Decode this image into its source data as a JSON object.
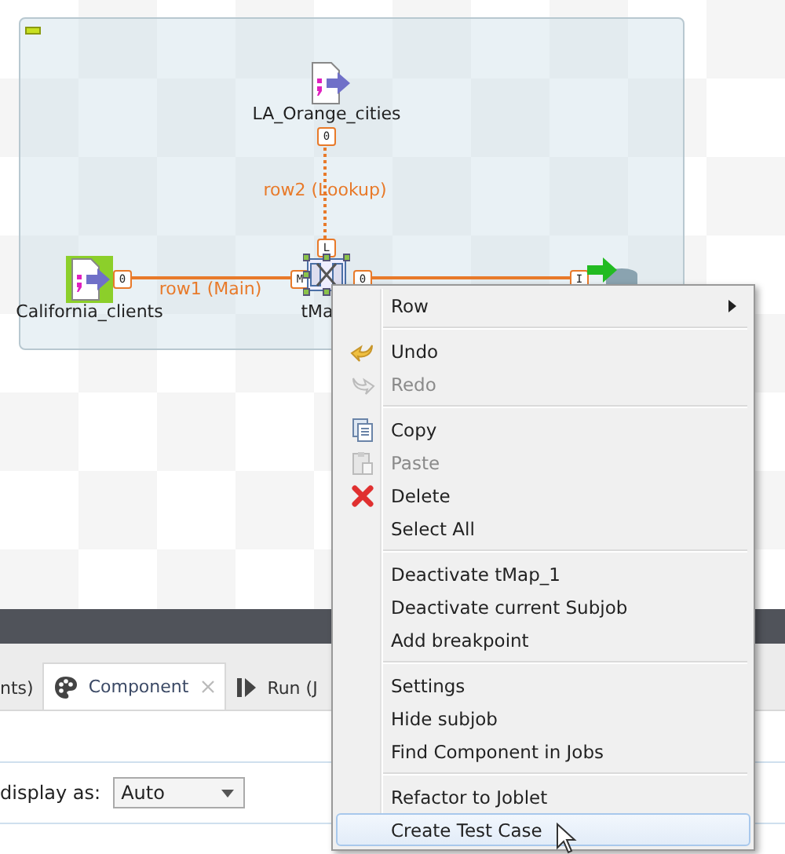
{
  "canvas": {
    "nodes": [
      {
        "label": "California_clients",
        "kind": "file_input",
        "selected": false
      },
      {
        "label": "LA_Orange_cities",
        "kind": "file_input",
        "selected": false
      },
      {
        "label": "tMa",
        "kind": "map",
        "selected": true
      },
      {
        "kind": "db_output",
        "selected": false
      }
    ],
    "links": [
      {
        "label": "row1 (Main)",
        "kind": "main",
        "from_port": "0",
        "to_port": "M"
      },
      {
        "label": "row2 (Lookup)",
        "kind": "lookup",
        "from_port": "0",
        "to_port": "L"
      },
      {
        "kind": "main",
        "from_port": "0",
        "to_port": "I"
      }
    ]
  },
  "tabs": [
    {
      "label": "nts)",
      "kind": "plain",
      "selected": false
    },
    {
      "label": "Component",
      "kind": "component",
      "selected": true
    },
    {
      "label": "Run (J",
      "kind": "run",
      "selected": false
    }
  ],
  "panel": {
    "label": "display as:",
    "select": {
      "value": "Auto"
    }
  },
  "context_menu": {
    "sections": [
      [
        {
          "label": "Row",
          "kind": "submenu",
          "disabled": false,
          "selected": false
        }
      ],
      [
        {
          "label": "Undo",
          "kind": "undo",
          "disabled": false,
          "selected": false
        },
        {
          "label": "Redo",
          "kind": "redo",
          "disabled": true,
          "selected": false
        }
      ],
      [
        {
          "label": "Copy",
          "kind": "copy",
          "disabled": false,
          "selected": false
        },
        {
          "label": "Paste",
          "kind": "paste",
          "disabled": true,
          "selected": false
        },
        {
          "label": "Delete",
          "kind": "delete",
          "disabled": false,
          "selected": false
        },
        {
          "label": "Select All",
          "kind": "plain",
          "disabled": false,
          "selected": false
        }
      ],
      [
        {
          "label": "Deactivate tMap_1",
          "kind": "plain",
          "disabled": false,
          "selected": false
        },
        {
          "label": "Deactivate current Subjob",
          "kind": "plain",
          "disabled": false,
          "selected": false
        },
        {
          "label": "Add breakpoint",
          "kind": "plain",
          "disabled": false,
          "selected": false
        }
      ],
      [
        {
          "label": "Settings",
          "kind": "plain",
          "disabled": false,
          "selected": false
        },
        {
          "label": "Hide subjob",
          "kind": "plain",
          "disabled": false,
          "selected": false
        },
        {
          "label": "Find Component in Jobs",
          "kind": "plain",
          "disabled": false,
          "selected": false
        }
      ],
      [
        {
          "label": "Refactor to Joblet",
          "kind": "plain",
          "disabled": false,
          "selected": false
        },
        {
          "label": "Create Test Case",
          "kind": "plain",
          "disabled": false,
          "selected": true
        }
      ]
    ]
  }
}
